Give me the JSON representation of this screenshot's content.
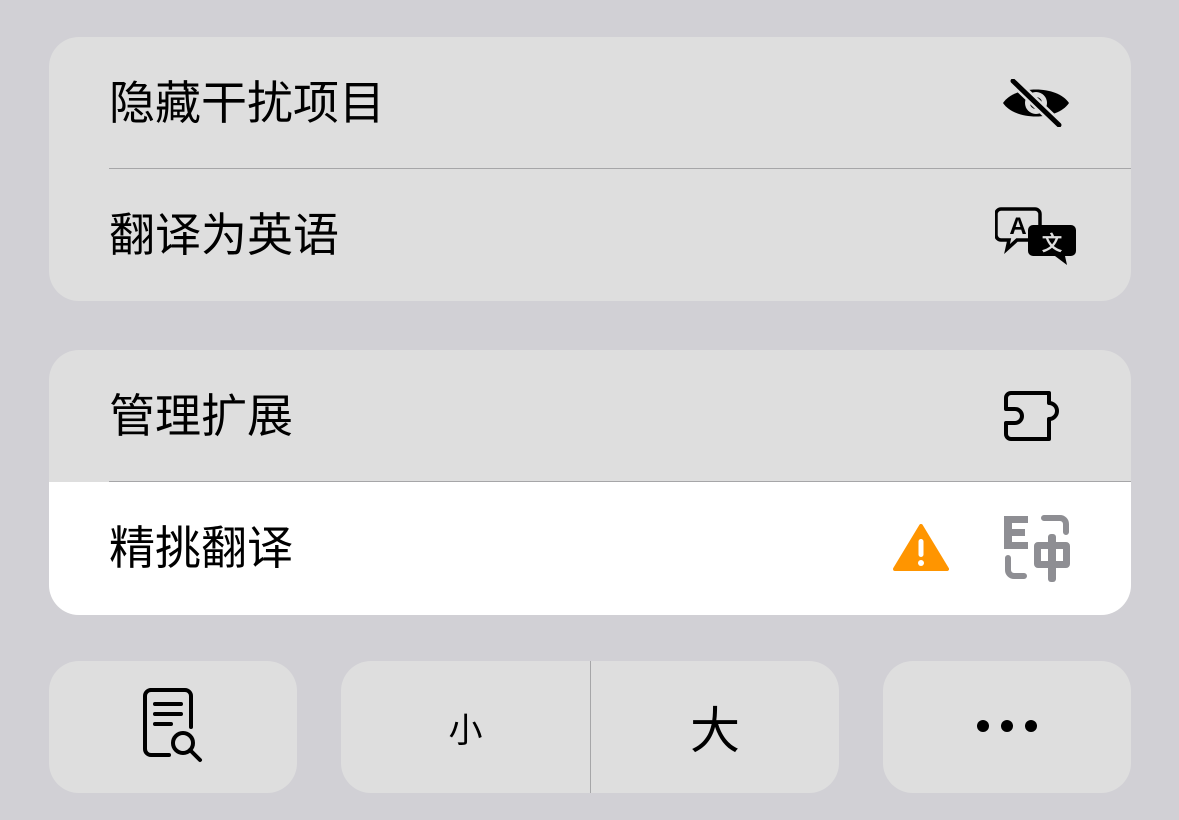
{
  "menu": {
    "group1": [
      {
        "label": "隐藏干扰项目",
        "icon": "eye-slash-icon"
      },
      {
        "label": "翻译为英语",
        "icon": "translate-bubble-icon"
      }
    ],
    "group2": [
      {
        "label": "管理扩展",
        "icon": "puzzle-extension-icon"
      },
      {
        "label": "精挑翻译",
        "icon": "e-zhong-translate-icon",
        "warning_icon": "warning-triangle-icon"
      }
    ]
  },
  "toolbar": {
    "reader_icon": "document-search-icon",
    "zoom_small_label": "小",
    "zoom_large_label": "大",
    "more_icon": "ellipsis-icon"
  },
  "colors": {
    "background": "#d1d0d5",
    "group": "#dedede",
    "highlight_row": "#ffffff",
    "warning": "#ff9500",
    "extension_icon_gray": "#8e8e93"
  }
}
